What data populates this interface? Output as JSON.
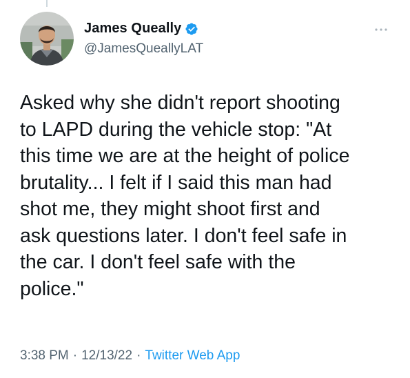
{
  "author": {
    "display_name": "James Queally",
    "handle": "@JamesQueallyLAT",
    "verified": true,
    "avatar_icon": "profile-photo"
  },
  "tweet": {
    "text": "Asked why she didn't report shooting\nto LAPD during the vehicle stop: \"At\nthis time we are at the height of police\nbrutality... I felt if I said this man had\nshot me, they might shoot first and\nask questions later. I don't feel safe in\nthe car. I don't feel safe with the\npolice.\"",
    "time": "3:38 PM",
    "date": "12/13/22",
    "source": "Twitter Web App",
    "separator": "·"
  },
  "menu": {
    "more_icon": "more-horizontal-icon"
  },
  "colors": {
    "text_primary": "#0f1419",
    "text_secondary": "#536471",
    "accent": "#1d9bf0",
    "thread_line": "#cfd9de"
  }
}
